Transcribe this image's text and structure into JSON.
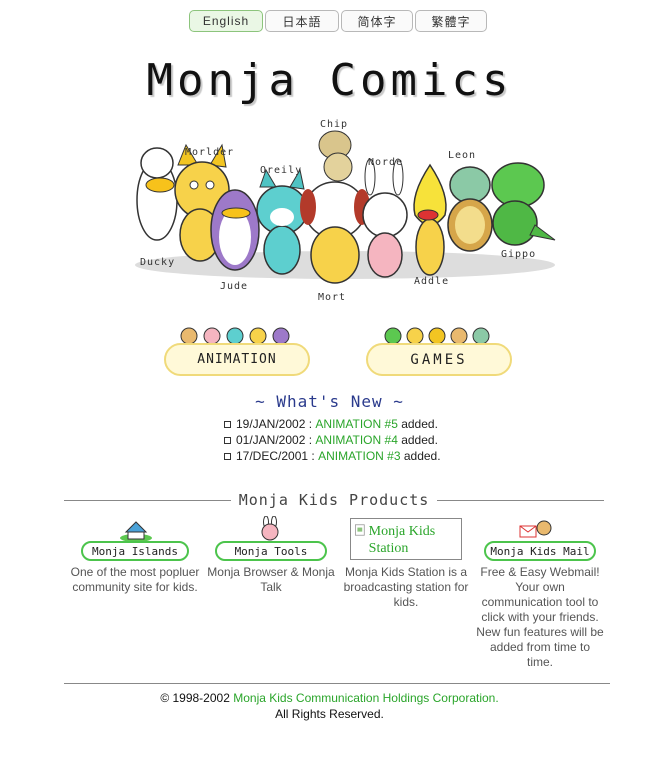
{
  "languages": [
    "English",
    "日本語",
    "简体字",
    "繁體字"
  ],
  "site_title": "Monja Comics",
  "characters": [
    "Chip",
    "Morlder",
    "Oreily",
    "Norde",
    "Leon",
    "Ducky",
    "Jude",
    "Mort",
    "Addle",
    "Gippo"
  ],
  "nav": {
    "animation": "ANIMATION",
    "games": "GAMES"
  },
  "whats_new": {
    "title": "~ What's New ~",
    "items": [
      {
        "date": "19/JAN/2002",
        "sep": " : ",
        "link": "ANIMATION #5",
        "suffix": " added."
      },
      {
        "date": "01/JAN/2002",
        "sep": " : ",
        "link": "ANIMATION #4",
        "suffix": " added."
      },
      {
        "date": "17/DEC/2001",
        "sep": " : ",
        "link": "ANIMATION #3",
        "suffix": " added."
      }
    ]
  },
  "products": {
    "title": "Monja Kids Products",
    "items": [
      {
        "name": "Monja Islands",
        "desc": "One of the most popluer community site for kids."
      },
      {
        "name": "Monja Tools",
        "desc": "Monja Browser & Monja Talk"
      },
      {
        "name": "Monja Kids Station",
        "desc": "Monja Kids Station is a broadcasting station for kids."
      },
      {
        "name": "Monja Kids Mail",
        "desc": "Free & Easy Webmail! Your own communication tool to click with your friends. New fun features will be added from time to time."
      }
    ]
  },
  "footer": {
    "copyright_prefix": "© 1998-2002 ",
    "company": "Monja Kids Communication Holdings Corporation.",
    "rights": "All Rights Reserved."
  },
  "colors": {
    "link": "#2aa52a",
    "title_blue": "#2a3a8c",
    "pill_fill": "#fff9d8",
    "product_border": "#4cc44c"
  }
}
